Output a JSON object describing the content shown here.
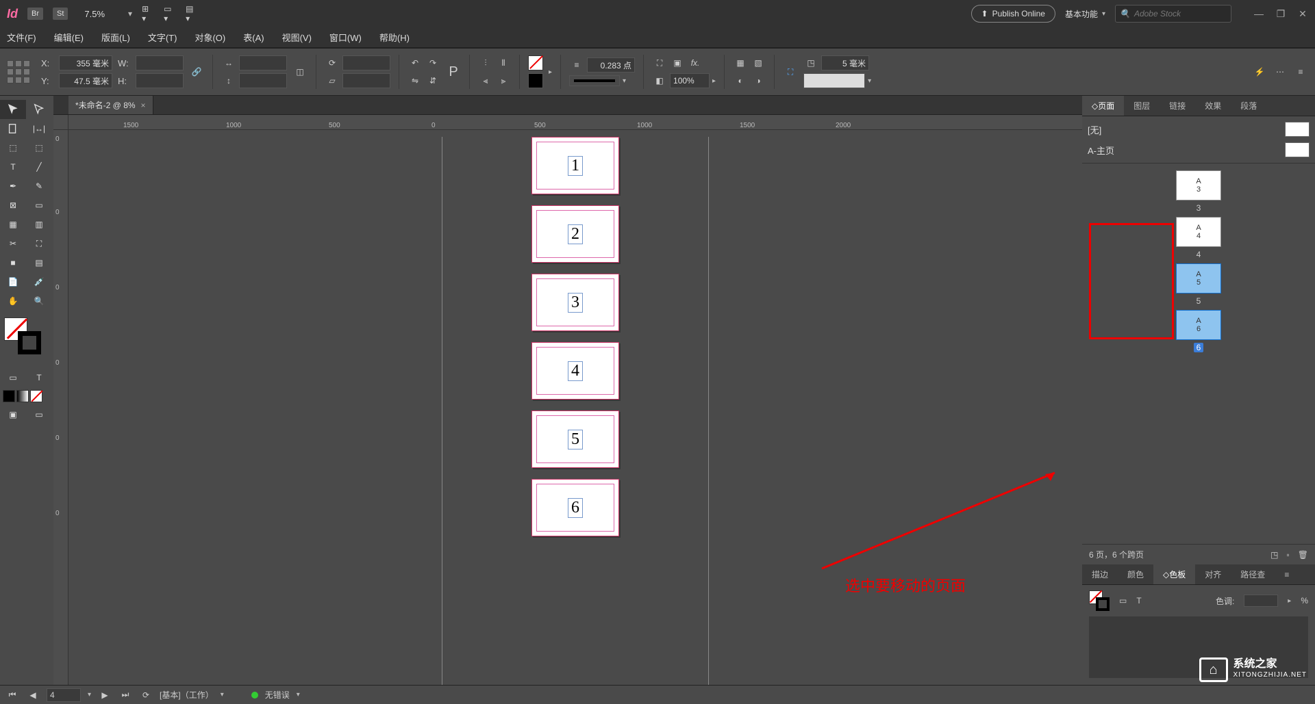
{
  "app": {
    "logo": "Id",
    "bridge": "Br",
    "stock_btn": "St",
    "zoom": "7.5%",
    "publish": "Publish Online",
    "workspace": "基本功能",
    "stock_placeholder": "Adobe Stock"
  },
  "menu": {
    "file": "文件(F)",
    "edit": "编辑(E)",
    "layout": "版面(L)",
    "type": "文字(T)",
    "object": "对象(O)",
    "table": "表(A)",
    "view": "视图(V)",
    "window": "窗口(W)",
    "help": "帮助(H)"
  },
  "control": {
    "x_label": "X:",
    "y_label": "Y:",
    "w_label": "W:",
    "h_label": "H:",
    "x_value": "355 毫米",
    "y_value": "47.5 毫米",
    "w_value": "",
    "h_value": "",
    "stroke_weight": "0.283 点",
    "opacity": "100%",
    "corner_value": "5 毫米"
  },
  "tab": {
    "title": "*未命名-2 @ 8%"
  },
  "ruler_h": [
    "1500",
    "1000",
    "500",
    "0",
    "500",
    "1000",
    "1500",
    "2000"
  ],
  "ruler_v": [
    "0",
    "0",
    "0",
    "0",
    "0",
    "0"
  ],
  "pages": [
    "1",
    "2",
    "3",
    "4",
    "5",
    "6"
  ],
  "panels": {
    "pages": "页面",
    "layers": "图层",
    "links": "链接",
    "effects": "效果",
    "paragraph": "段落",
    "none_master": "[无]",
    "a_master": "A-主页",
    "thumbs": [
      {
        "master": "A",
        "num": "3",
        "label": "3",
        "selected": false
      },
      {
        "master": "A",
        "num": "4",
        "label": "4",
        "selected": false
      },
      {
        "master": "A",
        "num": "5",
        "label": "5",
        "selected": true
      },
      {
        "master": "A",
        "num": "6",
        "label": "6",
        "selected": true
      }
    ],
    "footer": "6 页，6 个跨页",
    "stroke_tab": "描边",
    "color_tab": "颜色",
    "swatch_tab": "色板",
    "align_tab": "对齐",
    "path_tab": "路径查",
    "tint_label": "色调:",
    "tint_unit": "%"
  },
  "status": {
    "page_value": "4",
    "base": "[基本]（工作）",
    "errors": "无错误"
  },
  "annotation": "选中要移动的页面",
  "watermark": {
    "brand": "系统之家",
    "url": "XITONGZHIJIA.NET"
  }
}
